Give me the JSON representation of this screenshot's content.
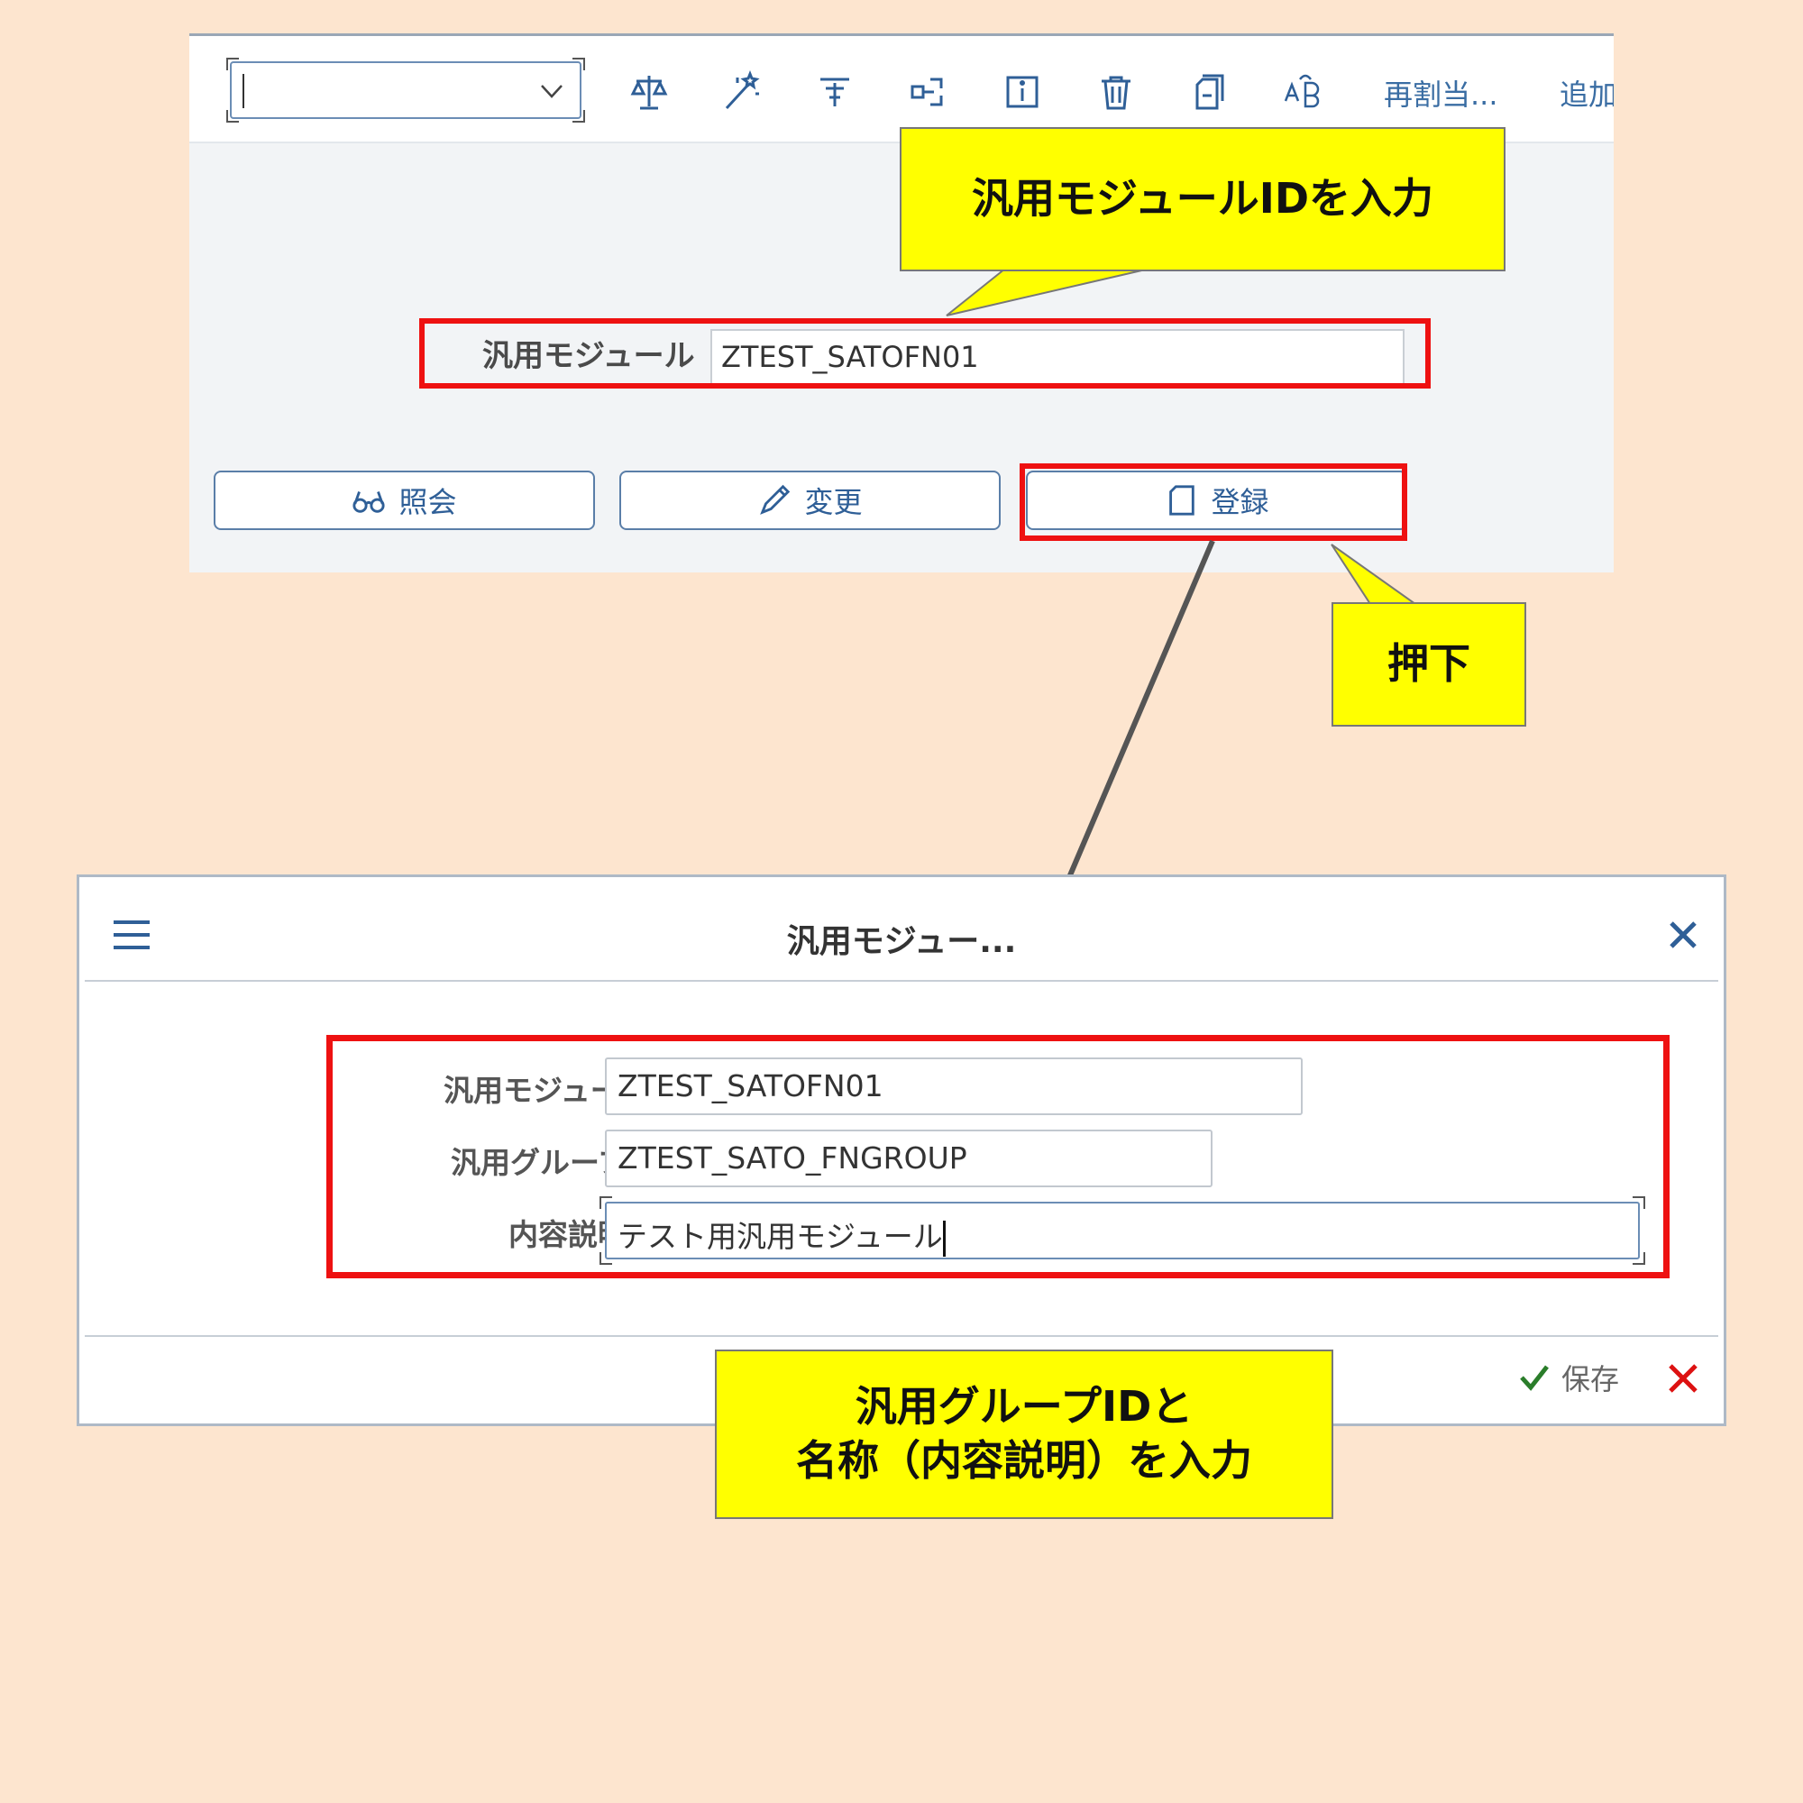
{
  "toolbar": {
    "command_field_value": "",
    "icons": [
      "balance-scale-icon",
      "magic-wand-icon",
      "filter-icon",
      "where-used-icon",
      "info-icon",
      "trash-icon",
      "copy-icon",
      "rename-icon"
    ],
    "reassign_label": "再割当...",
    "add_label": "追加"
  },
  "main": {
    "function_module_label": "汎用モジュール",
    "function_module_value": "ZTEST_SATOFN01",
    "buttons": {
      "display": "照会",
      "change": "変更",
      "create": "登録"
    }
  },
  "callouts": {
    "enter_module_id": "汎用モジュールIDを入力",
    "press": "押下",
    "enter_group": [
      "汎用グループIDと",
      "名称（内容説明）を入力"
    ]
  },
  "dialog": {
    "title": "汎用モジュー...",
    "fields": {
      "module_label": "汎用モジュール",
      "module_value": "ZTEST_SATOFN01",
      "group_label": "汎用グループ:",
      "group_value": "ZTEST_SATO_FNGROUP",
      "description_label": "内容説明:",
      "description_value": "テスト用汎用モジュール"
    },
    "required_mark": "*",
    "save_label": "保存"
  },
  "colors": {
    "background": "#fde5cf",
    "highlight": "#ee1111",
    "callout": "#ffff00",
    "sap_blue": "#2f5f97",
    "close_red": "#d11"
  }
}
